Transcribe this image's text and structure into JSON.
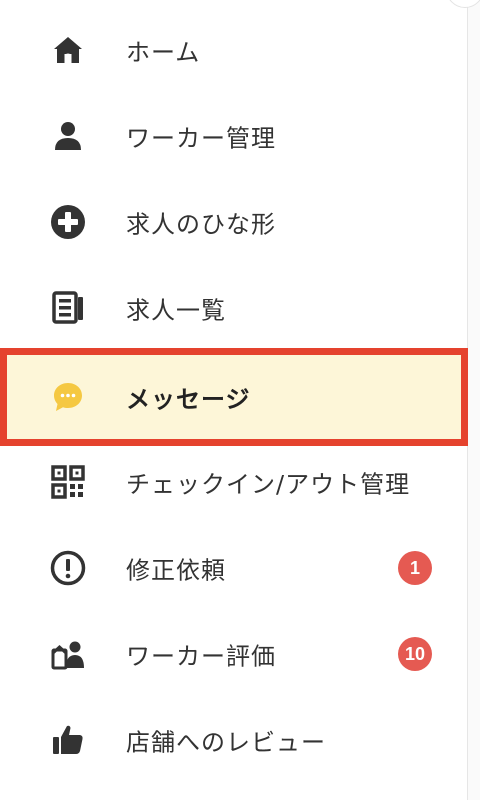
{
  "nav": {
    "items": [
      {
        "label": "ホーム",
        "icon": "home-icon"
      },
      {
        "label": "ワーカー管理",
        "icon": "person-icon"
      },
      {
        "label": "求人のひな形",
        "icon": "plus-circle-icon"
      },
      {
        "label": "求人一覧",
        "icon": "list-icon"
      },
      {
        "label": "メッセージ",
        "icon": "chat-bubble-icon",
        "active": true
      },
      {
        "label": "チェックイン/アウト管理",
        "icon": "qr-code-icon"
      },
      {
        "label": "修正依頼",
        "icon": "exclamation-circle-icon",
        "badge": "1"
      },
      {
        "label": "ワーカー評価",
        "icon": "worker-rating-icon",
        "badge": "10"
      },
      {
        "label": "店舗へのレビュー",
        "icon": "thumbs-up-icon"
      }
    ]
  },
  "colors": {
    "active_bg": "#fdf6d8",
    "active_border": "#e5432e",
    "badge": "#e55a52",
    "chat_icon": "#f5c842",
    "icon": "#333333"
  }
}
